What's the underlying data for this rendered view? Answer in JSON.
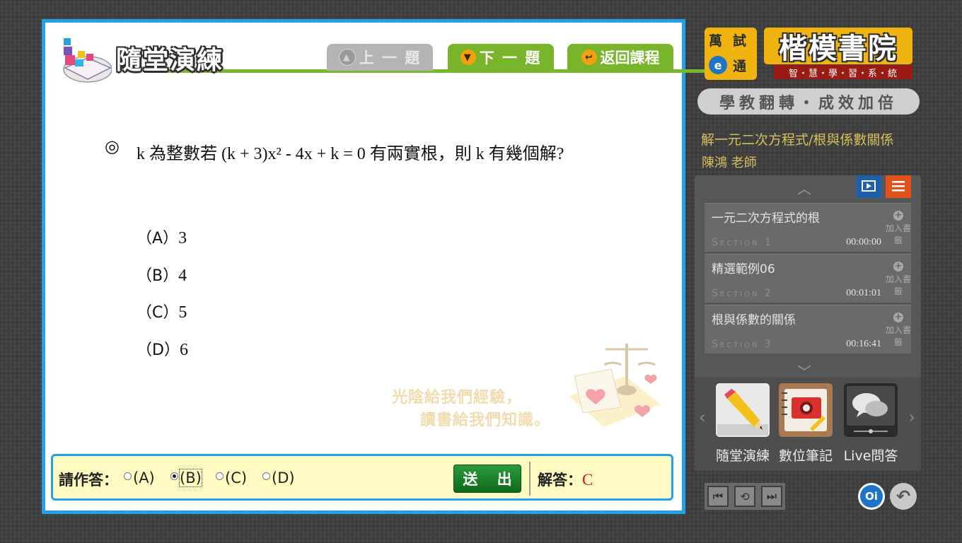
{
  "quiz": {
    "title": "隨堂演練",
    "prev_label": "上 一 題",
    "next_label": "下 一 題",
    "back_label": "返回課程",
    "question_mark": "◎",
    "question_text": "k 為整數若 (k + 3)x² - 4x + k = 0 有兩實根，則 k 有幾個解?",
    "options": [
      {
        "label": "（A）",
        "value": "3"
      },
      {
        "label": "（B）",
        "value": "4"
      },
      {
        "label": "（C）",
        "value": "5"
      },
      {
        "label": "（D）",
        "value": "6"
      }
    ],
    "watermark_line1": "光陰給我們經驗，",
    "watermark_line2": "讀書給我們知識。"
  },
  "answer_bar": {
    "prompt": "請作答：",
    "choices": [
      "(A)",
      "(B)",
      "(C)",
      "(D)"
    ],
    "selected": "(B)",
    "submit_label": "送 出",
    "answer_label": "解答：",
    "answer_value": "C"
  },
  "brand": {
    "wan": "萬",
    "shi": "試",
    "e": "e",
    "tong": "通",
    "name": "楷模書院",
    "subtitle": "智・慧・學・習・系・統",
    "slogan": "學教翻轉・成效加倍"
  },
  "course": {
    "title": "解一元二次方程式/根與係數關係",
    "teacher": "陳鴻  老師"
  },
  "sections": [
    {
      "title": "一元二次方程式的根",
      "label": "Section 1",
      "time": "00:00:00",
      "bookmark": "加入書籤"
    },
    {
      "title": "精選範例06",
      "label": "Section 2",
      "time": "00:01:01",
      "bookmark": "加入書籤"
    },
    {
      "title": "根與係數的關係",
      "label": "Section 3",
      "time": "00:16:41",
      "bookmark": "加入書籤"
    }
  ],
  "tools": [
    {
      "label": "隨堂演練",
      "icon": "pencil-icon"
    },
    {
      "label": "數位筆記",
      "icon": "notebook-icon"
    },
    {
      "label": "Live問答",
      "icon": "chat-icon"
    }
  ],
  "oi_label": "Oi",
  "colors": {
    "accent_blue": "#21a3e6",
    "accent_green": "#78b52b",
    "answer_red": "#e0101a",
    "brand_gold": "#f0b30f"
  }
}
